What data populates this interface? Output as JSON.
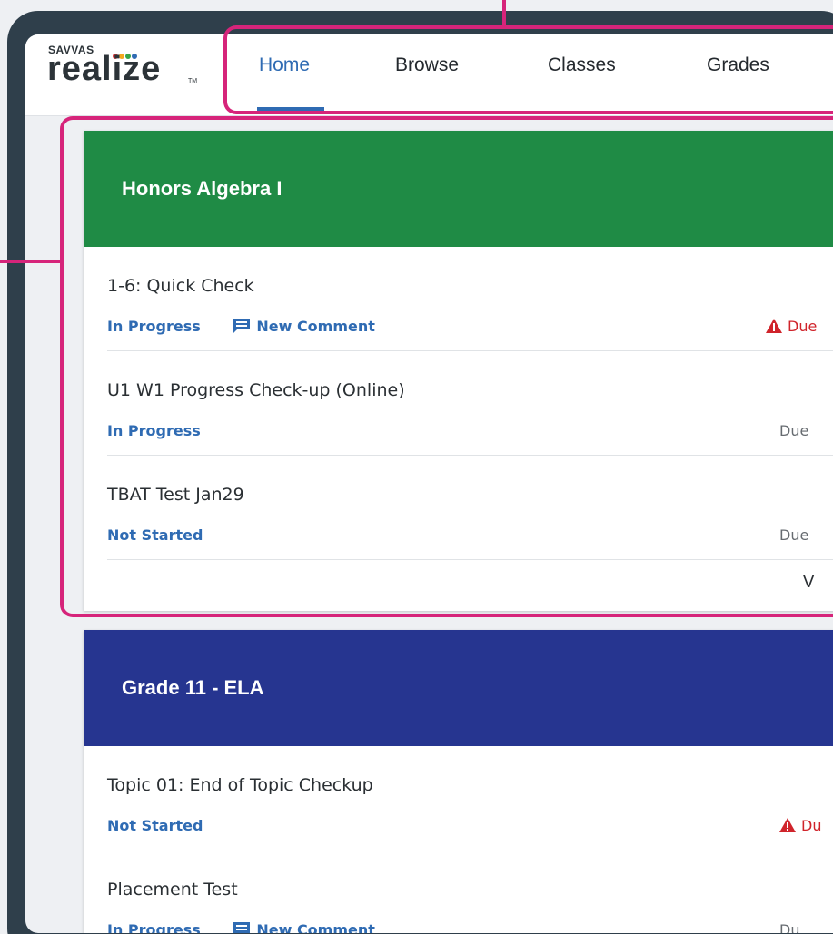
{
  "logo": {
    "brand_small": "SAVVAS",
    "wordmark": "realize",
    "tm": "TM"
  },
  "nav": {
    "tabs": [
      {
        "label": "Home",
        "active": true
      },
      {
        "label": "Browse",
        "active": false
      },
      {
        "label": "Classes",
        "active": false
      },
      {
        "label": "Grades",
        "active": false
      }
    ]
  },
  "classes": [
    {
      "name": "Honors Algebra I",
      "color": "#1f8b45",
      "items": [
        {
          "title": "1-6: Quick Check",
          "status": "In Progress",
          "comment": "New Comment",
          "due": "Due",
          "overdue": true
        },
        {
          "title": "U1 W1 Progress Check-up (Online)",
          "status": "In Progress",
          "due": "Due",
          "overdue": false
        },
        {
          "title": "TBAT Test Jan29",
          "status": "Not Started",
          "due": "Due",
          "overdue": false
        }
      ],
      "view_all": "V"
    },
    {
      "name": "Grade 11 - ELA",
      "color": "#263590",
      "items": [
        {
          "title": "Topic 01: End of Topic Checkup",
          "status": "Not Started",
          "due": "Du",
          "overdue": true
        },
        {
          "title": "Placement Test",
          "status": "In Progress",
          "comment": "New Comment",
          "due": "Du",
          "overdue": false
        }
      ]
    }
  ],
  "colors": {
    "highlight": "#d6247a",
    "accent": "#2f6bb3",
    "alert": "#d0242b",
    "logo_dots": [
      "#e23b3b",
      "#f4a81d",
      "#37a447",
      "#2f6bb3"
    ]
  }
}
